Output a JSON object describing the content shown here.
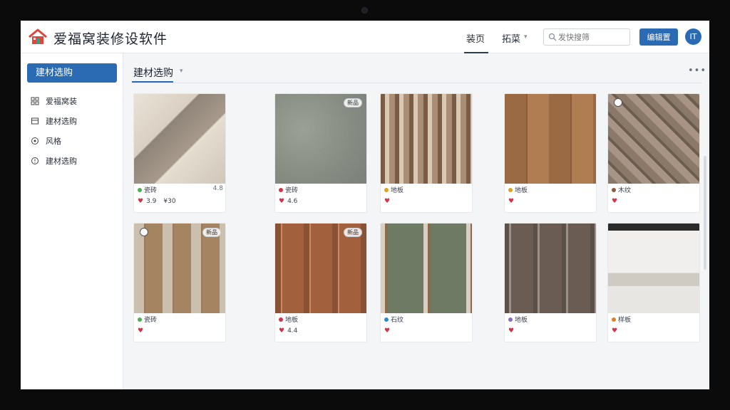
{
  "app": {
    "title": "爱福窝装修设软件",
    "nav_home": "装页",
    "nav_more": "拓菜",
    "search_placeholder": "发快搜筛",
    "primary_button": "编辑置",
    "avatar_text": "IT"
  },
  "sidebar": {
    "active": "建材选购",
    "items": [
      {
        "label": "爱福窝装",
        "icon": "grid-icon"
      },
      {
        "label": "建材选购",
        "icon": "box-icon"
      },
      {
        "label": "风格",
        "icon": "palette-icon"
      },
      {
        "label": "建材选购",
        "icon": "cart-icon"
      }
    ]
  },
  "content": {
    "title": "建材选购",
    "more": "•••"
  },
  "colors": {
    "accent": "#2a6bb3",
    "heart": "#d6334a"
  },
  "cards": [
    {
      "name": "瓷砖",
      "meta": "4.8",
      "likes": "3.9",
      "views": "¥30",
      "dot": "#4caf50",
      "badge": "",
      "swatch": "stone"
    },
    {
      "name": "瓷砖",
      "meta": "",
      "likes": "4.6",
      "views": "",
      "dot": "#d6334a",
      "badge": "新品",
      "swatch": "grey"
    },
    {
      "name": "地板",
      "meta": "",
      "likes": "",
      "views": "",
      "dot": "#e0a020",
      "badge": "",
      "swatch": "plank-light"
    },
    {
      "name": "地板",
      "meta": "",
      "likes": "",
      "views": "",
      "dot": "#e0a020",
      "badge": "",
      "swatch": "plank-mid"
    },
    {
      "name": "木纹",
      "meta": "",
      "likes": "",
      "views": "",
      "dot": "#8a5a3a",
      "badge": "",
      "swatch": "chevron"
    },
    {
      "name": "瓷砖",
      "meta": "",
      "likes": "",
      "views": "",
      "dot": "#4caf50",
      "badge": "新品",
      "swatch": "mix"
    },
    {
      "name": "地板",
      "meta": "",
      "likes": "4.4",
      "views": "",
      "dot": "#d6334a",
      "badge": "新品",
      "swatch": "plank-red"
    },
    {
      "name": "石纹",
      "meta": "",
      "likes": "",
      "views": "",
      "dot": "#2a8ad6",
      "badge": "",
      "swatch": "green"
    },
    {
      "name": "地板",
      "meta": "",
      "likes": "",
      "views": "",
      "dot": "#8a6ac6",
      "badge": "",
      "swatch": "dark"
    },
    {
      "name": "样板",
      "meta": "",
      "likes": "",
      "views": "",
      "dot": "#e08020",
      "badge": "",
      "swatch": "room"
    }
  ]
}
